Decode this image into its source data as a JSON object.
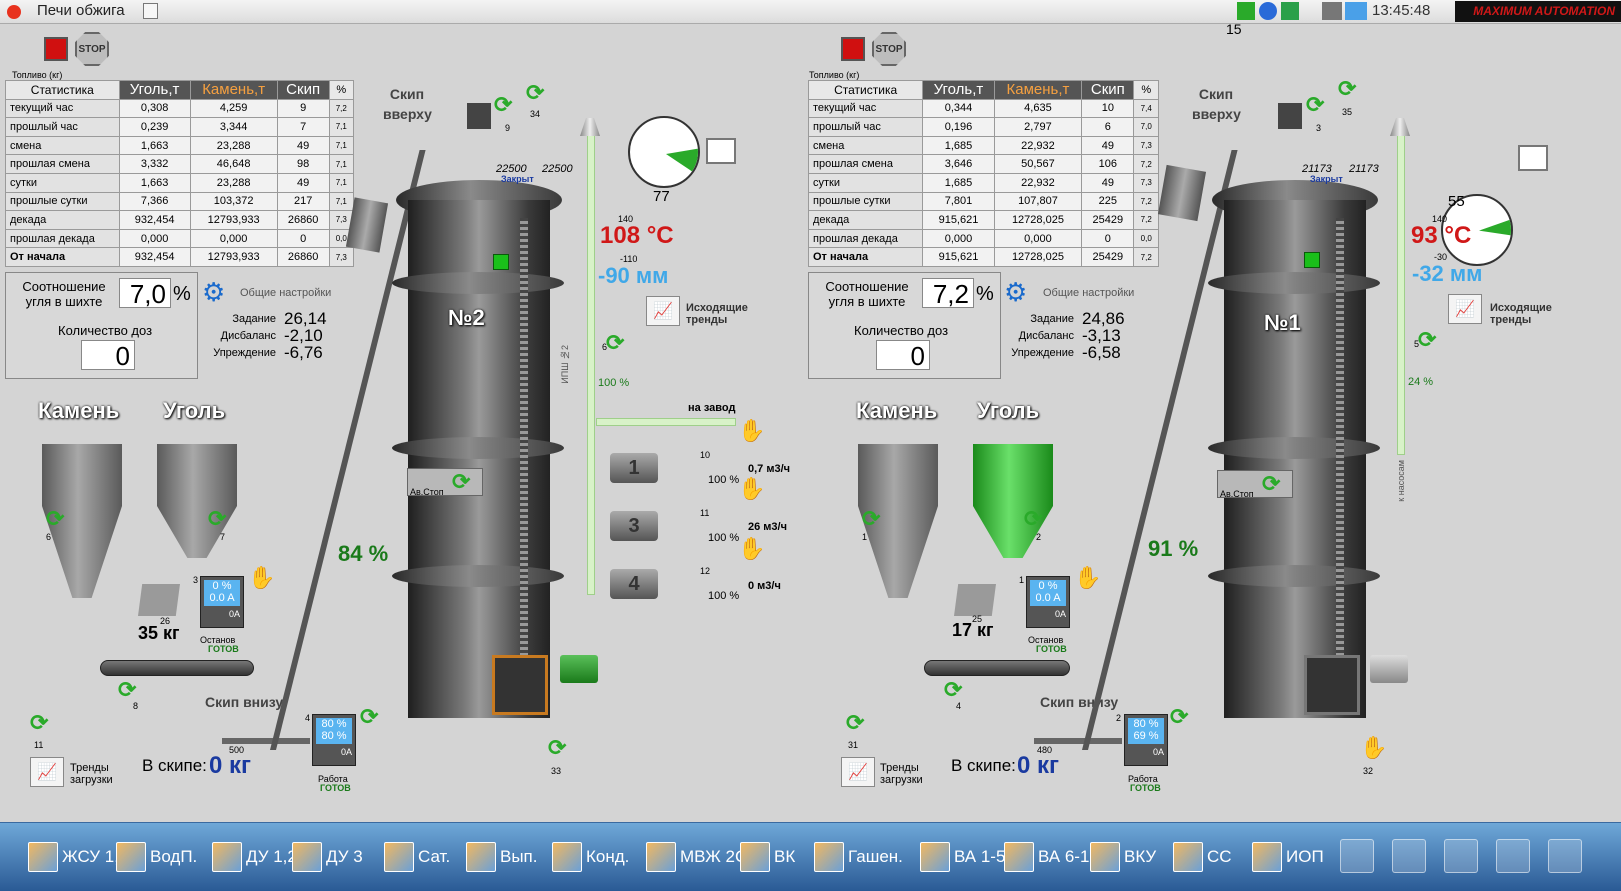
{
  "window": {
    "title": "Печи обжига",
    "time": "13:45:48",
    "counter": "15",
    "brand": "MAXIMUM AUTOMATION"
  },
  "stop_label": "STOP",
  "fuel_label": "Топливо (кг)",
  "table_headers": [
    "Статистика",
    "Уголь,т",
    "Камень,т",
    "Скип",
    "%"
  ],
  "row_labels": [
    "текущий час",
    "прошлый час",
    "смена",
    "прошлая смена",
    "сутки",
    "прошлые сутки",
    "декада",
    "прошлая декада",
    "От начала"
  ],
  "settings_label": "Общие настройки",
  "coal_ratio_label": "Соотношение угля в шихте",
  "dose_count_label": "Количество доз",
  "task_label": "Задание",
  "imbalance_label": "Дисбаланс",
  "lead_label": "Упреждение",
  "stone_label": "Камень",
  "coal_label": "Уголь",
  "skip_up_label": "Скип вверху",
  "skip_down_label": "Скип внизу",
  "in_skip_label": "В скипе:",
  "trends_load_label": "Тренды загрузки",
  "trends_out_label": "Исходящие тренды",
  "av_stop_label": "Ав.Стоп",
  "closed_label": "Закрыт",
  "stop_ready": "Останов",
  "work_ready": "Работа",
  "ready": "ГОТОВ",
  "to_plant": "на завод",
  "to_pumps": "к насосам",
  "ipsh": "ИПШ №2",
  "furnace2": {
    "name": "№2",
    "rows": [
      [
        "0,308",
        "4,259",
        "9",
        "7,2"
      ],
      [
        "0,239",
        "3,344",
        "7",
        "7,1"
      ],
      [
        "1,663",
        "23,288",
        "49",
        "7,1"
      ],
      [
        "3,332",
        "46,648",
        "98",
        "7,1"
      ],
      [
        "1,663",
        "23,288",
        "49",
        "7,1"
      ],
      [
        "7,366",
        "103,372",
        "217",
        "7,1"
      ],
      [
        "932,454",
        "12793,933",
        "26860",
        "7,3"
      ],
      [
        "0,000",
        "0,000",
        "0",
        "0,0"
      ],
      [
        "932,454",
        "12793,933",
        "26860",
        "7,3"
      ]
    ],
    "ratio": "7,0",
    "pct": "%",
    "doses": "0",
    "task": "26,14",
    "imbalance": "-2,10",
    "lead": "-6,76",
    "temp_small": "140",
    "temp": "108 °C",
    "press_small": "-110",
    "press": "-90 мм",
    "valve_pct": "100 %",
    "skip_level": "84 %",
    "dial_value": "77",
    "gate_a": "22500",
    "gate_b": "22500",
    "kg": "35 кг",
    "kg_small": "26",
    "in_skip": "0 кг",
    "skip_small": "500",
    "m1_top": "0 %",
    "m1_bot": "0.0 A",
    "m2_top": "80 %",
    "m2_bot": "80 %",
    "m_a": "0A",
    "pumps": [
      {
        "num": "1",
        "idx": "10",
        "flow": "0,7 м3/ч",
        "pct": "100 %"
      },
      {
        "num": "3",
        "idx": "11",
        "flow": "26 м3/ч",
        "pct": "100 %"
      },
      {
        "num": "4",
        "idx": "12",
        "flow": "0 м3/ч",
        "pct": "100 %"
      }
    ],
    "ids": {
      "a": "9",
      "b": "34",
      "c": "6",
      "d": "7",
      "e": "8",
      "f": "11",
      "g": "3",
      "h": "4",
      "i": "33",
      "j": "6"
    }
  },
  "furnace1": {
    "name": "№1",
    "rows": [
      [
        "0,344",
        "4,635",
        "10",
        "7,4"
      ],
      [
        "0,196",
        "2,797",
        "6",
        "7,0"
      ],
      [
        "1,685",
        "22,932",
        "49",
        "7,3"
      ],
      [
        "3,646",
        "50,567",
        "106",
        "7,2"
      ],
      [
        "1,685",
        "22,932",
        "49",
        "7,3"
      ],
      [
        "7,801",
        "107,807",
        "225",
        "7,2"
      ],
      [
        "915,621",
        "12728,025",
        "25429",
        "7,2"
      ],
      [
        "0,000",
        "0,000",
        "0",
        "0,0"
      ],
      [
        "915,621",
        "12728,025",
        "25429",
        "7,2"
      ]
    ],
    "ratio": "7,2",
    "pct": "%",
    "doses": "0",
    "task": "24,86",
    "imbalance": "-3,13",
    "lead": "-6,58",
    "temp_small": "140",
    "temp": "93 °C",
    "press_small": "-30",
    "press": "-32 мм",
    "valve_pct": "24 %",
    "skip_level": "91 %",
    "dial_value": "55",
    "gate_a": "21173",
    "gate_b": "21173",
    "kg": "17 кг",
    "kg_small": "25",
    "in_skip": "0 кг",
    "skip_small": "480",
    "m1_top": "0 %",
    "m1_bot": "0.0 A",
    "m2_top": "80 %",
    "m2_bot": "69 %",
    "m_a": "0A",
    "ids": {
      "a": "3",
      "b": "35",
      "c": "5",
      "d": "1",
      "e": "4",
      "f": "31",
      "g": "1",
      "h": "2",
      "i": "32",
      "j": "2"
    }
  },
  "taskbar": [
    "ЖСУ 1,2",
    "ВодП.",
    "ДУ 1,2",
    "ДУ 3",
    "Сат.",
    "Вып.",
    "Конд.",
    "МВЖ 2С",
    "ВК",
    "Гашен.",
    "ВА 1-5",
    "ВА 6-10",
    "ВКУ",
    "СС",
    "ИОП"
  ],
  "colors": {
    "hot": "#d01818",
    "press": "#40a8e8",
    "level": "#1a7a1a",
    "on": "#2aaa2a"
  }
}
